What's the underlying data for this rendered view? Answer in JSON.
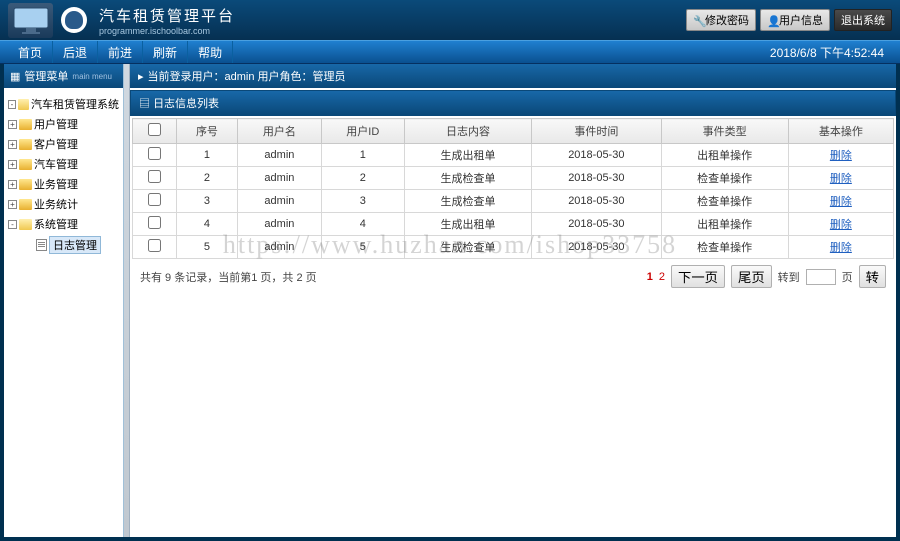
{
  "header": {
    "title": "汽车租赁管理平台",
    "subtitle": "programmer.ischoolbar.com",
    "buttons": {
      "change_pwd": "修改密码",
      "user_info": "用户信息",
      "logout": "退出系统"
    }
  },
  "nav": {
    "items": [
      "首页",
      "后退",
      "前进",
      "刷新",
      "帮助"
    ],
    "datetime": "2018/6/8 下午4:52:44"
  },
  "sidebar": {
    "header": "管理菜单",
    "header_sub": "main menu",
    "tree": [
      {
        "label": "汽车租赁管理系统",
        "exp": "-",
        "open": true
      },
      {
        "label": "用户管理",
        "exp": "+"
      },
      {
        "label": "客户管理",
        "exp": "+"
      },
      {
        "label": "汽车管理",
        "exp": "+"
      },
      {
        "label": "业务管理",
        "exp": "+"
      },
      {
        "label": "业务统计",
        "exp": "+"
      },
      {
        "label": "系统管理",
        "exp": "-",
        "open": true
      },
      {
        "label": "日志管理",
        "nested": true,
        "selected": true
      }
    ]
  },
  "main": {
    "crumb": "当前登录用户：admin  用户角色：管理员",
    "panel_title": "日志信息列表",
    "columns": [
      "",
      "序号",
      "用户名",
      "用户ID",
      "日志内容",
      "事件时间",
      "事件类型",
      "基本操作"
    ],
    "rows": [
      {
        "seq": "1",
        "uname": "admin",
        "uid": "1",
        "content": "生成出租单",
        "time": "2018-05-30",
        "type": "出租单操作",
        "op": "删除"
      },
      {
        "seq": "2",
        "uname": "admin",
        "uid": "2",
        "content": "生成检查单",
        "time": "2018-05-30",
        "type": "检查单操作",
        "op": "删除"
      },
      {
        "seq": "3",
        "uname": "admin",
        "uid": "3",
        "content": "生成检查单",
        "time": "2018-05-30",
        "type": "检查单操作",
        "op": "删除"
      },
      {
        "seq": "4",
        "uname": "admin",
        "uid": "4",
        "content": "生成出租单",
        "time": "2018-05-30",
        "type": "出租单操作",
        "op": "删除"
      },
      {
        "seq": "5",
        "uname": "admin",
        "uid": "5",
        "content": "生成检查单",
        "time": "2018-05-30",
        "type": "检查单操作",
        "op": "删除"
      }
    ],
    "pagination": {
      "summary": "共有 9 条记录，当前第1 页，共 2 页",
      "pages": [
        "1",
        "2"
      ],
      "next": "下一页",
      "last": "尾页",
      "goto_prefix": "转到",
      "goto_suffix": "页",
      "go": "转"
    }
  },
  "watermark": "https://www.huzhan.com/ishop33758"
}
